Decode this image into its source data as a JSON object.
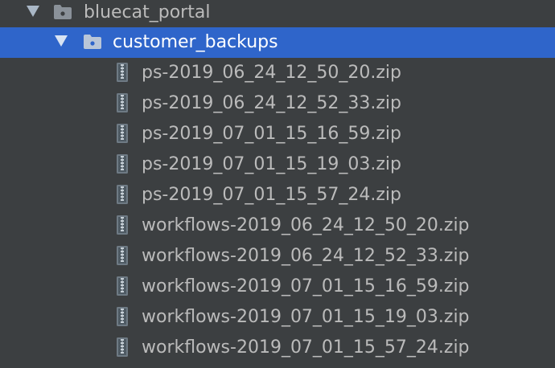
{
  "tree": {
    "root": {
      "label": "bluecat_portal",
      "expanded": true,
      "icon": "folder-icon"
    },
    "folder": {
      "label": "customer_backups",
      "expanded": true,
      "selected": true,
      "icon": "folder-icon"
    },
    "files": [
      {
        "label": "ps-2019_06_24_12_50_20.zip",
        "icon": "zip-archive-icon"
      },
      {
        "label": "ps-2019_06_24_12_52_33.zip",
        "icon": "zip-archive-icon"
      },
      {
        "label": "ps-2019_07_01_15_16_59.zip",
        "icon": "zip-archive-icon"
      },
      {
        "label": "ps-2019_07_01_15_19_03.zip",
        "icon": "zip-archive-icon"
      },
      {
        "label": "ps-2019_07_01_15_57_24.zip",
        "icon": "zip-archive-icon"
      },
      {
        "label": "workflows-2019_06_24_12_50_20.zip",
        "icon": "zip-archive-icon"
      },
      {
        "label": "workflows-2019_06_24_12_52_33.zip",
        "icon": "zip-archive-icon"
      },
      {
        "label": "workflows-2019_07_01_15_16_59.zip",
        "icon": "zip-archive-icon"
      },
      {
        "label": "workflows-2019_07_01_15_19_03.zip",
        "icon": "zip-archive-icon"
      },
      {
        "label": "workflows-2019_07_01_15_57_24.zip",
        "icon": "zip-archive-icon"
      }
    ]
  },
  "colors": {
    "background": "#3c3f41",
    "selection": "#2f65ca",
    "text": "#bbbbbb",
    "selected_text": "#ffffff"
  }
}
